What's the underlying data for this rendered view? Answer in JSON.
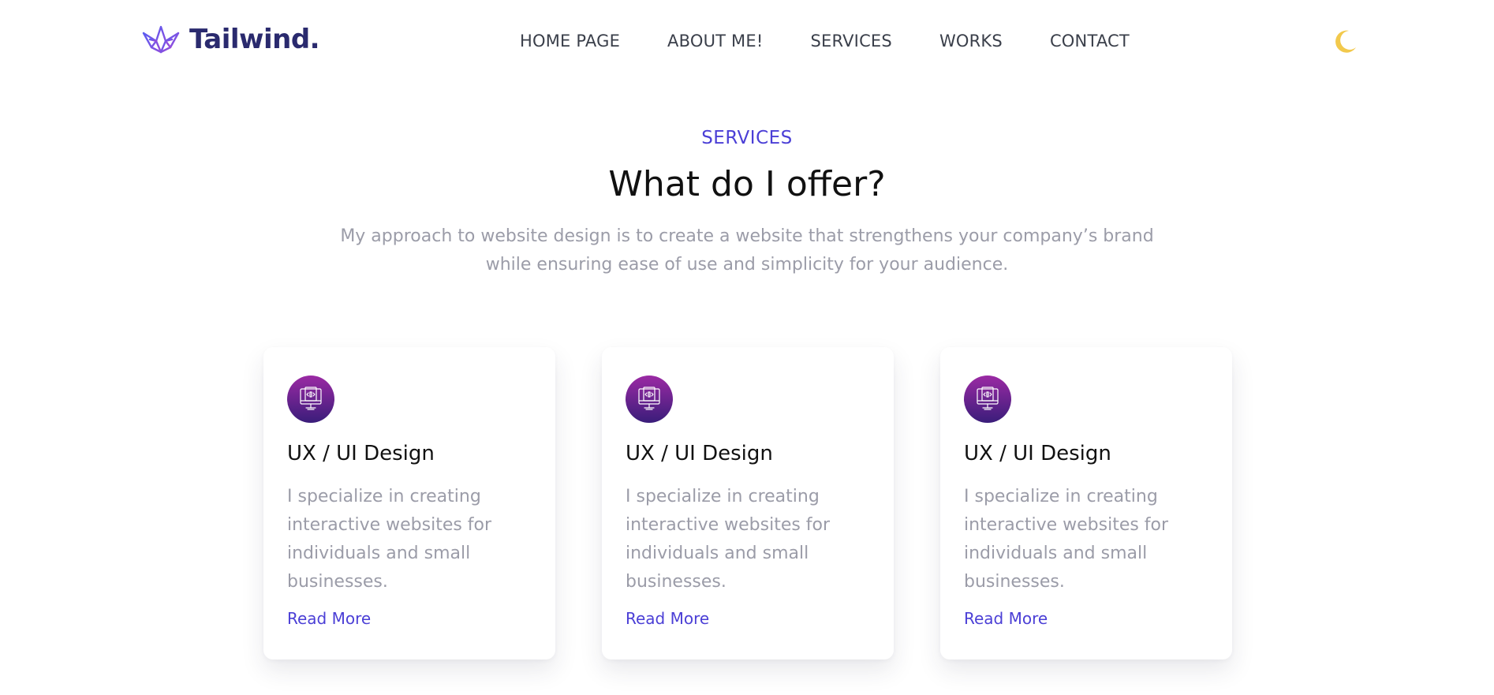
{
  "header": {
    "logo_text": "Tailwind.",
    "logo_icon": "crown-icon",
    "nav": [
      {
        "label": "HOME PAGE"
      },
      {
        "label": "ABOUT ME!"
      },
      {
        "label": "SERVICES"
      },
      {
        "label": "WORKS"
      },
      {
        "label": "CONTACT"
      }
    ],
    "theme_icon": "moon-icon"
  },
  "services": {
    "eyebrow": "SERVICES",
    "headline": "What do I offer?",
    "intro": "My approach to website design is to create a website that strengthens your company’s brand while ensuring ease of use and simplicity for your audience.",
    "cards": [
      {
        "icon": "monitor-code-icon",
        "title": "UX / UI Design",
        "text": "I specialize in creating interactive websites for individuals and small businesses.",
        "link": "Read More"
      },
      {
        "icon": "monitor-code-icon",
        "title": "UX / UI Design",
        "text": "I specialize in creating interactive websites for individuals and small businesses.",
        "link": "Read More"
      },
      {
        "icon": "monitor-code-icon",
        "title": "UX / UI Design",
        "text": "I specialize in creating interactive websites for individuals and small businesses.",
        "link": "Read More"
      }
    ]
  },
  "colors": {
    "accent": "#4b3fd6",
    "brand_dark": "#2a2a6e",
    "icon_gradient_top": "#9b2aa4",
    "icon_gradient_bottom": "#3a1d7a",
    "moon": "#f2c94c",
    "muted_text": "#9b9ca8"
  }
}
